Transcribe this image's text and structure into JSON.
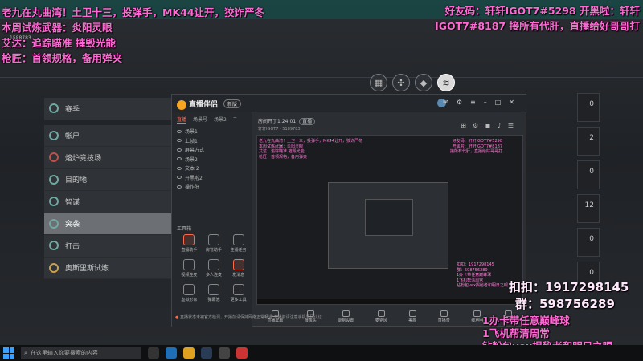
{
  "overlay": {
    "left_lines": [
      "老九在丸曲湾！土卫十三，投弹手，MK44让开，狡诈严冬",
      "本周试炼武器：炎阳灵眼",
      "艾达：追踪瞄准 摧毁光能",
      "枪匠：首领规格，备用弹夹"
    ],
    "right_lines": [
      "好友码：轩轩IGOT7#5298",
      "开黑啦：轩轩IGOT7#8187",
      "接所有代肝，直播给好哥哥打"
    ],
    "qq": "扣扣：1917298145",
    "group": "群：598756289",
    "promo_lines": [
      "1办卡带任意巅峰球",
      "1飞机帮清周常",
      "钻粉包vex揭秘者和明日之眼"
    ],
    "faint_id": "1588783"
  },
  "game_menu": {
    "items": [
      {
        "label": "赛季",
        "icon": "season-icon"
      },
      {
        "label": "帐户",
        "icon": "account-icon"
      },
      {
        "label": "熔炉竞技场",
        "icon": "crucible-icon"
      },
      {
        "label": "目的地",
        "icon": "destination-icon"
      },
      {
        "label": "智谋",
        "icon": "gambit-icon"
      },
      {
        "label": "突袭",
        "icon": "raid-icon"
      },
      {
        "label": "打击",
        "icon": "strike-icon"
      },
      {
        "label": "奥斯里斯试炼",
        "icon": "trials-icon"
      }
    ],
    "selected_index": 5
  },
  "nav_icons": [
    "grid-icon",
    "map-icon",
    "diamond-icon",
    "vanguard-icon"
  ],
  "right_panels": [
    "0",
    "2",
    "0",
    "0",
    "12",
    "0",
    "0",
    "0"
  ],
  "app": {
    "title": "直播伴侣",
    "version": "新版",
    "tabs": [
      "直播",
      "场景号",
      "场景2",
      "+"
    ],
    "scenes": [
      "场景1",
      "上帧1",
      "屏幕方式",
      "场景2",
      "文本 2",
      "开黑啦2",
      "操作肝"
    ],
    "tools_title": "工具箱",
    "tools": [
      "直播助手",
      "房管助手",
      "主播任务",
      "视频连麦",
      "多人连麦",
      "发消息",
      "虚拟形象",
      "弹幕池",
      "更多工具"
    ],
    "room_line": "房间开了1:24:01",
    "room_tag": "直播",
    "room_id": "轩轩IGOT7 · 5189783",
    "bottom_tools": [
      "直播屏幕",
      "摄像头",
      "录制设置",
      "麦克风",
      "美颜",
      "直播音",
      "线声明",
      "设置"
    ],
    "footer_warn": "直播状态未被官方检测，开播前请保持网络正常畅通",
    "footer": "开播前请注意手机号码认证"
  },
  "taskbar": {
    "search_placeholder": "在这里输入你要搜索的内容"
  }
}
